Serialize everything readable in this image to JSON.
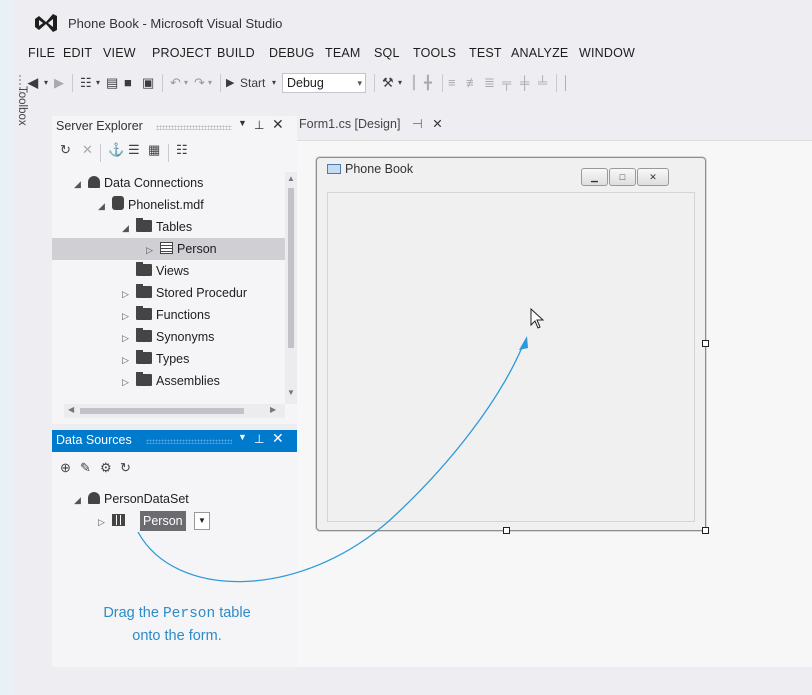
{
  "window": {
    "title": "Phone Book - Microsoft Visual Studio"
  },
  "menu": [
    "FILE",
    "EDIT",
    "VIEW",
    "PROJECT",
    "BUILD",
    "DEBUG",
    "TEAM",
    "SQL",
    "TOOLS",
    "TEST",
    "ANALYZE",
    "WINDOW"
  ],
  "toolbar": {
    "start_label": "Start",
    "config_value": "Debug"
  },
  "toolbox": {
    "label": "Toolbox"
  },
  "server_explorer": {
    "title": "Server Explorer",
    "tree": [
      {
        "label": "Data Connections"
      },
      {
        "label": "Phonelist.mdf"
      },
      {
        "label": "Tables"
      },
      {
        "label": "Person"
      },
      {
        "label": "Views"
      },
      {
        "label": "Stored Procedur"
      },
      {
        "label": "Functions"
      },
      {
        "label": "Synonyms"
      },
      {
        "label": "Types"
      },
      {
        "label": "Assemblies"
      }
    ]
  },
  "data_sources": {
    "title": "Data Sources",
    "dataset": "PersonDataSet",
    "table": "Person"
  },
  "document_tab": {
    "label": "Form1.cs [Design]"
  },
  "form": {
    "title": "Phone Book"
  },
  "annotation": {
    "prefix": "Drag the ",
    "code": "Person",
    "suffix": " table",
    "line2": "onto the form."
  },
  "colors": {
    "accent": "#007acc",
    "annotation": "#2b8cc9"
  }
}
